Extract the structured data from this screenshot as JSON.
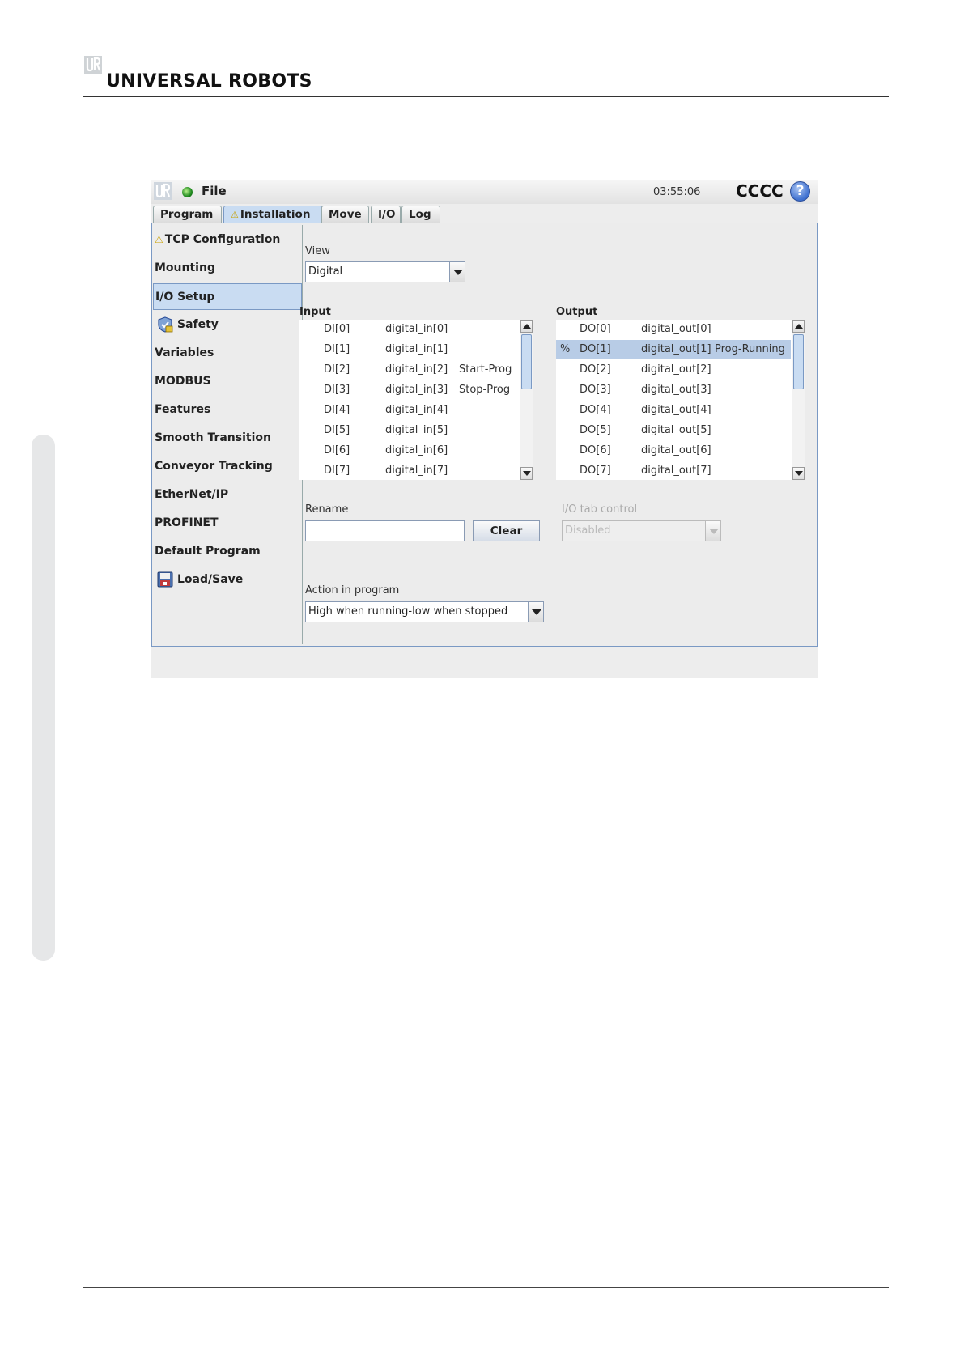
{
  "document": {
    "brand": "UNIVERSAL ROBOTS"
  },
  "topbar": {
    "file_label": "File",
    "time": "03:55:06",
    "robot_name": "CCCC",
    "help_glyph": "?"
  },
  "tabs": [
    {
      "label": "Program"
    },
    {
      "label": "Installation",
      "warn": "⚠",
      "active": true
    },
    {
      "label": "Move"
    },
    {
      "label": "I/O"
    },
    {
      "label": "Log"
    }
  ],
  "nav": {
    "items": [
      {
        "label": "TCP Configuration",
        "icon": "warning-icon"
      },
      {
        "label": "Mounting"
      },
      {
        "label": "I/O Setup",
        "selected": true
      },
      {
        "label": "Safety",
        "icon": "safety-shield-icon"
      },
      {
        "label": "Variables"
      },
      {
        "label": "MODBUS"
      },
      {
        "label": "Features"
      },
      {
        "label": "Smooth Transition"
      },
      {
        "label": "Conveyor Tracking"
      },
      {
        "label": "EtherNet/IP"
      },
      {
        "label": "PROFINET"
      },
      {
        "label": "Default Program"
      },
      {
        "label": "Load/Save",
        "icon": "floppy-disk-icon"
      }
    ]
  },
  "io_setup": {
    "view_label": "View",
    "view_value": "Digital",
    "input_label": "Input",
    "output_label": "Output",
    "inputs": [
      {
        "id": "DI[0]",
        "name": "digital_in[0]",
        "func": ""
      },
      {
        "id": "DI[1]",
        "name": "digital_in[1]",
        "func": ""
      },
      {
        "id": "DI[2]",
        "name": "digital_in[2]",
        "func": "Start-Prog"
      },
      {
        "id": "DI[3]",
        "name": "digital_in[3]",
        "func": "Stop-Prog"
      },
      {
        "id": "DI[4]",
        "name": "digital_in[4]",
        "func": ""
      },
      {
        "id": "DI[5]",
        "name": "digital_in[5]",
        "func": ""
      },
      {
        "id": "DI[6]",
        "name": "digital_in[6]",
        "func": ""
      },
      {
        "id": "DI[7]",
        "name": "digital_in[7]",
        "func": ""
      }
    ],
    "outputs": [
      {
        "mark": "",
        "id": "DO[0]",
        "name": "digital_out[0]",
        "func": ""
      },
      {
        "mark": "%",
        "id": "DO[1]",
        "name": "digital_out[1]",
        "func": "Prog-Running",
        "selected": true
      },
      {
        "mark": "",
        "id": "DO[2]",
        "name": "digital_out[2]",
        "func": ""
      },
      {
        "mark": "",
        "id": "DO[3]",
        "name": "digital_out[3]",
        "func": ""
      },
      {
        "mark": "",
        "id": "DO[4]",
        "name": "digital_out[4]",
        "func": ""
      },
      {
        "mark": "",
        "id": "DO[5]",
        "name": "digital_out[5]",
        "func": ""
      },
      {
        "mark": "",
        "id": "DO[6]",
        "name": "digital_out[6]",
        "func": ""
      },
      {
        "mark": "",
        "id": "DO[7]",
        "name": "digital_out[7]",
        "func": ""
      }
    ],
    "rename_label": "Rename",
    "rename_value": "",
    "clear_label": "Clear",
    "io_tab_control_label": "I/O tab control",
    "io_tab_control_value": "Disabled",
    "action_label": "Action in program",
    "action_value": "High when running-low when stopped"
  },
  "colors": {
    "accent": "#c9dcf2",
    "accent_border": "#7a99c4",
    "warning": "#c8a000"
  }
}
